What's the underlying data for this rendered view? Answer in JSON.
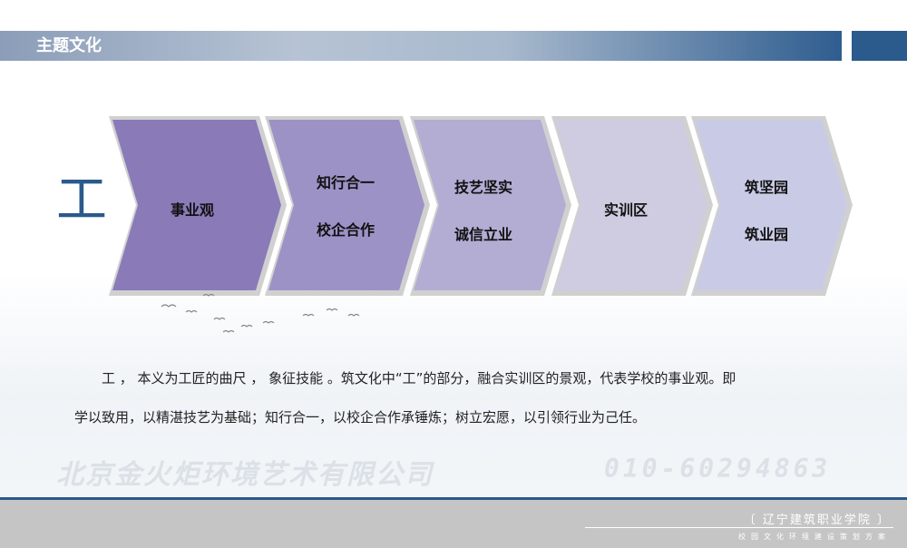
{
  "header": {
    "title": "主题文化"
  },
  "big_char": "工",
  "chevrons": [
    {
      "lines": [
        "事业观"
      ]
    },
    {
      "lines": [
        "知行合一",
        "校企合作"
      ]
    },
    {
      "lines": [
        "技艺坚实",
        "诚信立业"
      ]
    },
    {
      "lines": [
        "实训区"
      ]
    },
    {
      "lines": [
        "筑坚园",
        "筑业园"
      ]
    }
  ],
  "chevron_colors": [
    "#8a7ab8",
    "#9d92c6",
    "#b3acd3",
    "#cfcbe0",
    "#c9cbe6"
  ],
  "body": {
    "line1": "工 ， 本义为工匠的曲尺 ， 象征技能 。筑文化中“工”的部分，融合实训区的景观，代表学校的事业观。即",
    "line2": "学以致用，以精湛技艺为基础；知行合一，以校企合作承锤炼；树立宏愿，以引领行业为己任。"
  },
  "watermark": {
    "company": "北京金火炬环境艺术有限公司",
    "phone": "010-60294863"
  },
  "footer": {
    "school": "〔 辽宁建筑职业学院 〕",
    "subtitle": "校园文化环境建设策划方案"
  }
}
